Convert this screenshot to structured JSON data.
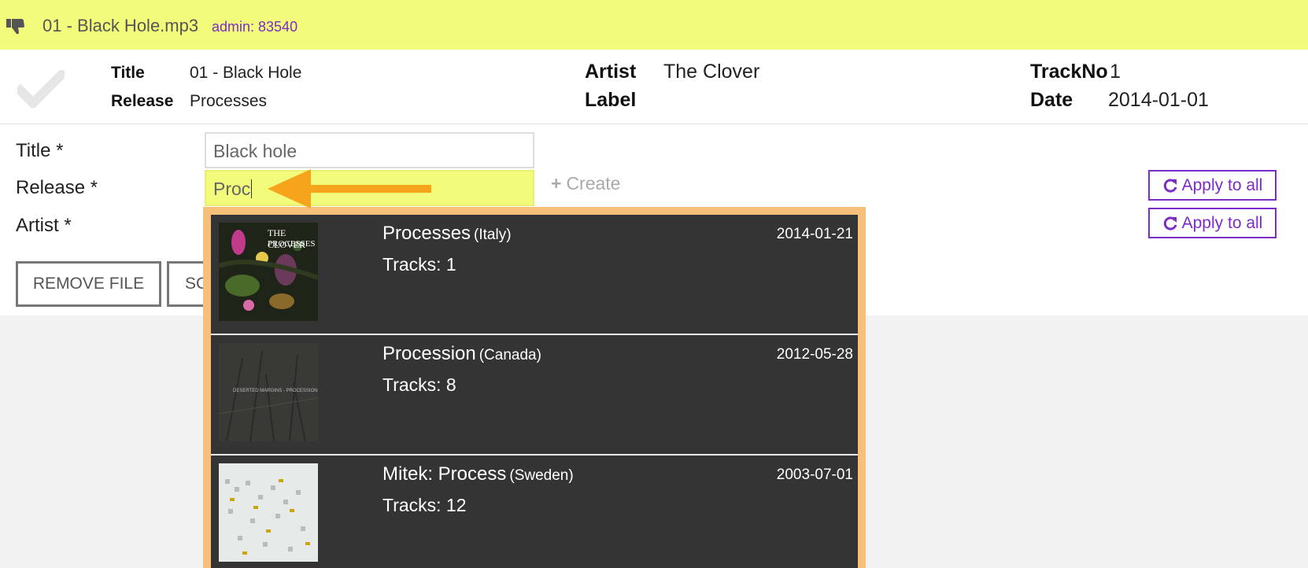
{
  "file": {
    "filename": "01 - Black Hole.mp3",
    "admin": "admin: 83540"
  },
  "meta": {
    "title_label": "Title",
    "title_value": "01 - Black Hole",
    "release_label": "Release",
    "release_value": "Processes",
    "artist_label": "Artist",
    "artist_value": "The Clover",
    "label_label": "Label",
    "label_value": "",
    "trackno_label": "TrackNo",
    "trackno_value": "1",
    "date_label": "Date",
    "date_value": "2014-01-01"
  },
  "form": {
    "title_label": "Title *",
    "title_value": "Black hole",
    "release_label": "Release *",
    "release_value": "Proc",
    "artist_label": "Artist *",
    "create_label": "Create",
    "apply_label": "Apply to all",
    "remove_label": "REMOVE FILE",
    "second_button_label": "SC"
  },
  "results": [
    {
      "name": "Processes",
      "country": "(Italy)",
      "tracks": "Tracks: 1",
      "date": "2014-01-21",
      "cover_text_1": "THE CLOVER",
      "cover_text_2": "PROCESSES"
    },
    {
      "name": "Procession",
      "country": "(Canada)",
      "tracks": "Tracks: 8",
      "date": "2012-05-28",
      "cover_text_1": "DESERTED MARGINS - PROCESSION"
    },
    {
      "name": "Mitek: Process",
      "country": "(Sweden)",
      "tracks": "Tracks: 12",
      "date": "2003-07-01"
    }
  ],
  "colors": {
    "highlight": "#f3fb7a",
    "accent": "#7b2cc9",
    "arrow": "#f7a41d",
    "dropdown_border": "#f6c07a",
    "dropdown_bg": "#343434"
  },
  "icons": {
    "thumb": "thumbs-down-icon",
    "check": "checkmark-icon",
    "plus": "plus-icon",
    "refresh": "refresh-icon"
  }
}
